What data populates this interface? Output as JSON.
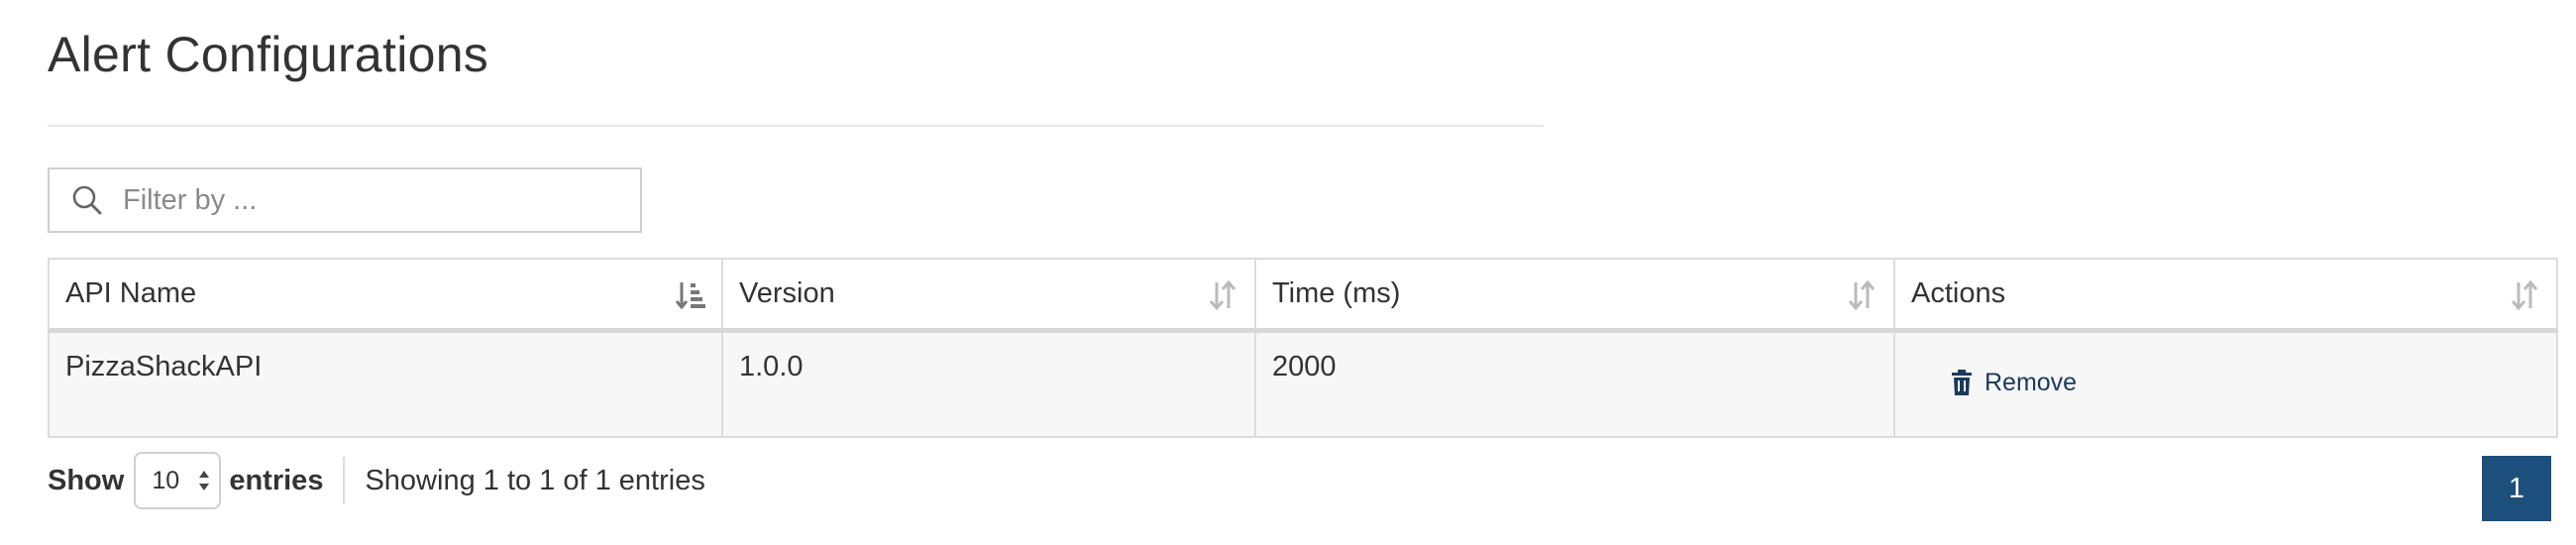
{
  "page": {
    "title": "Alert Configurations"
  },
  "filter": {
    "placeholder": "Filter by ...",
    "value": ""
  },
  "table": {
    "columns": [
      {
        "label": "API Name",
        "sort_state": "ascending"
      },
      {
        "label": "Version",
        "sort_state": "unsorted"
      },
      {
        "label": "Time (ms)",
        "sort_state": "unsorted"
      },
      {
        "label": "Actions",
        "sort_state": "unsorted"
      }
    ],
    "rows": [
      {
        "api_name": "PizzaShackAPI",
        "version": "1.0.0",
        "time_ms": "2000",
        "action_label": "Remove",
        "action_icon": "trash-icon"
      }
    ]
  },
  "footer": {
    "show_label": "Show",
    "page_size": "10",
    "entries_label": "entries",
    "info": "Showing 1 to 1 of 1 entries",
    "current_page": "1"
  },
  "colors": {
    "accent": "#1d4f7c",
    "action_text": "#1a3a5c",
    "border": "#dcdcdc"
  }
}
